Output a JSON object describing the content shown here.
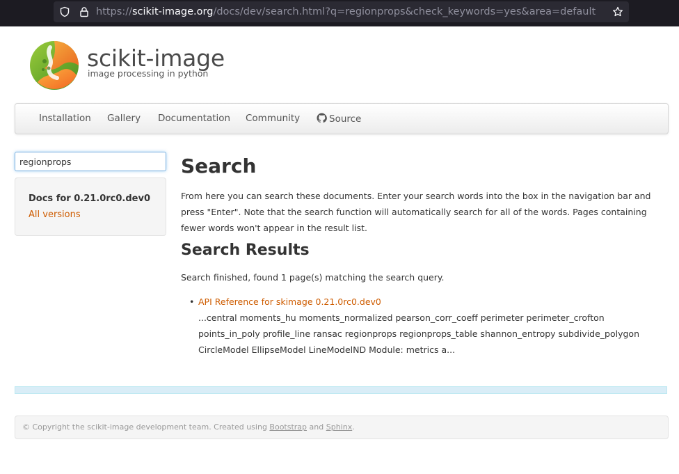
{
  "browser": {
    "url_scheme": "https://",
    "url_host": "scikit-image.org",
    "url_path": "/docs/dev/search.html?q=regionprops&check_keywords=yes&area=default"
  },
  "header": {
    "site_name": "scikit-image",
    "tagline": "image processing in python"
  },
  "nav": {
    "items": [
      "Installation",
      "Gallery",
      "Documentation",
      "Community",
      "Source"
    ]
  },
  "sidebar": {
    "search_value": "regionprops",
    "docs_version": "Docs for 0.21.0rc0.dev0",
    "all_versions": "All versions"
  },
  "main": {
    "title": "Search",
    "intro": "From here you can search these documents. Enter your search words into the box in the navigation bar and press \"Enter\". Note that the search function will automatically search for all of the words. Pages containing fewer words won't appear in the result list.",
    "results_heading": "Search Results",
    "status": "Search finished, found 1 page(s) matching the search query.",
    "results": [
      {
        "title": "API Reference for skimage 0.21.0rc0.dev0",
        "context": "...central moments_hu moments_normalized pearson_corr_coeff perimeter perimeter_crofton points_in_poly profile_line ransac regionprops regionprops_table shannon_entropy subdivide_polygon CircleModel EllipseModel LineModelND Module: metrics a..."
      }
    ]
  },
  "footer": {
    "prefix": "© Copyright the scikit-image development team. Created using ",
    "link1": "Bootstrap",
    "middle": " and ",
    "link2": "Sphinx",
    "suffix": "."
  },
  "colors": {
    "link": "#ce5c00",
    "chrome_bg": "#1c1b22",
    "urlbar_bg": "#2b2a33"
  }
}
